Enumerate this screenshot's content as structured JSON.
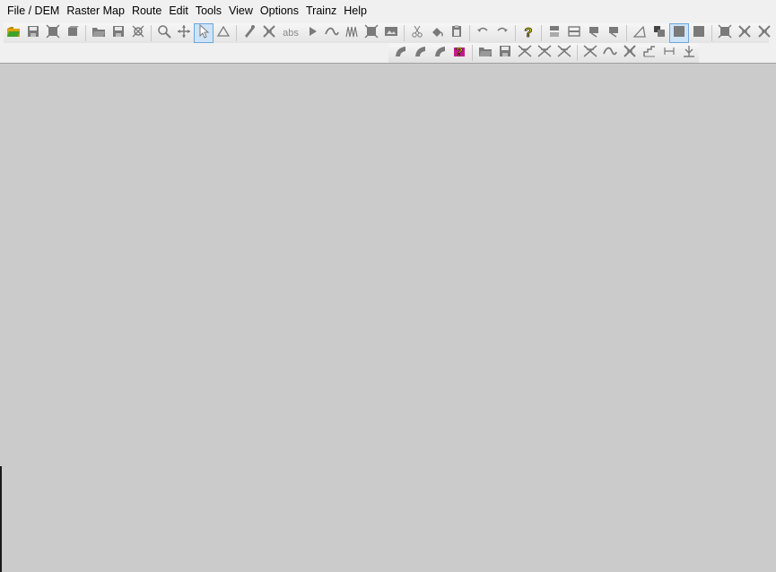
{
  "menu": [
    "File / DEM",
    "Raster Map",
    "Route",
    "Edit",
    "Tools",
    "View",
    "Options",
    "Trainz",
    "Help"
  ],
  "toolbar1": [
    {
      "name": "open-icon",
      "kind": "folder"
    },
    {
      "name": "save-icon",
      "kind": "disk"
    },
    {
      "name": "crop-icon",
      "kind": "frame"
    },
    {
      "name": "export-icon",
      "kind": "box"
    },
    {
      "sep": true
    },
    {
      "name": "open-raster-icon",
      "kind": "folderg"
    },
    {
      "name": "save-raster-icon",
      "kind": "disk"
    },
    {
      "name": "clear-icon",
      "kind": "clear"
    },
    {
      "sep": true
    },
    {
      "name": "zoom-icon",
      "kind": "zoom"
    },
    {
      "name": "pan-icon",
      "kind": "pan"
    },
    {
      "name": "select-icon",
      "kind": "arrow",
      "active": true
    },
    {
      "name": "measure-icon",
      "kind": "triangle"
    },
    {
      "sep": true
    },
    {
      "name": "pencil-icon",
      "kind": "pencil"
    },
    {
      "name": "cross-tool-icon",
      "kind": "cross"
    },
    {
      "name": "abs-text",
      "kind": "text",
      "text": "abs"
    },
    {
      "name": "play-icon",
      "kind": "play"
    },
    {
      "name": "curve-icon",
      "kind": "curve"
    },
    {
      "name": "waves-icon",
      "kind": "waves"
    },
    {
      "name": "frame-icon",
      "kind": "frame"
    },
    {
      "name": "image-icon",
      "kind": "image"
    },
    {
      "sep": true
    },
    {
      "name": "cut-icon",
      "kind": "cut"
    },
    {
      "name": "paint-icon",
      "kind": "paint"
    },
    {
      "name": "paste-icon",
      "kind": "paste"
    },
    {
      "sep": true
    },
    {
      "name": "undo-icon",
      "kind": "undo"
    },
    {
      "name": "redo-icon",
      "kind": "redo"
    },
    {
      "sep": true
    },
    {
      "name": "help-icon",
      "kind": "help"
    },
    {
      "sep": true
    },
    {
      "name": "layer1-icon",
      "kind": "layer"
    },
    {
      "name": "layer2-icon",
      "kind": "layer2"
    },
    {
      "name": "layer3-icon",
      "kind": "layer3"
    },
    {
      "name": "layer4-icon",
      "kind": "layer3"
    },
    {
      "sep": true
    },
    {
      "name": "angle-icon",
      "kind": "angle"
    },
    {
      "name": "stack-icon",
      "kind": "stack"
    },
    {
      "name": "square-active-icon",
      "kind": "square",
      "active": true
    },
    {
      "name": "square-icon",
      "kind": "square"
    },
    {
      "sep": true
    },
    {
      "name": "frame2-icon",
      "kind": "frame"
    },
    {
      "name": "cross2-icon",
      "kind": "cross"
    },
    {
      "name": "cross3-icon",
      "kind": "cross"
    }
  ],
  "toolbar2": [
    {
      "name": "track1-icon",
      "kind": "track"
    },
    {
      "name": "track2-icon",
      "kind": "track"
    },
    {
      "name": "track3-icon",
      "kind": "track"
    },
    {
      "name": "trainz-help-icon",
      "kind": "trainzhelp"
    },
    {
      "sep": true
    },
    {
      "name": "open-route-icon",
      "kind": "folderg"
    },
    {
      "name": "save-route-icon",
      "kind": "disk"
    },
    {
      "name": "split-icon",
      "kind": "split"
    },
    {
      "name": "split2-icon",
      "kind": "split"
    },
    {
      "name": "split3-icon",
      "kind": "split"
    },
    {
      "sep": true
    },
    {
      "name": "junction-icon",
      "kind": "split"
    },
    {
      "name": "line-icon",
      "kind": "curve"
    },
    {
      "name": "cross4-icon",
      "kind": "cross"
    },
    {
      "name": "graph-icon",
      "kind": "graph"
    },
    {
      "name": "distance-icon",
      "kind": "distance"
    },
    {
      "name": "signal-icon",
      "kind": "signal"
    }
  ],
  "colors": {
    "menubar": "#f0f0f0",
    "workspace": "#cbcbcb",
    "icon": "#7a7a7a",
    "active_border": "#6fa6d8"
  }
}
